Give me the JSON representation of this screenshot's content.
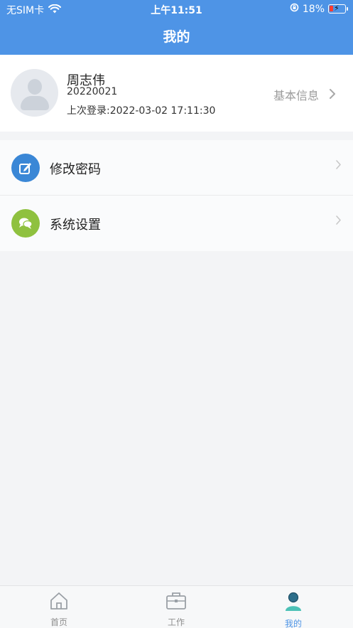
{
  "status_bar": {
    "carrier": "无SIM卡",
    "time": "上午11:51",
    "battery_percent": "18%"
  },
  "header": {
    "title": "我的"
  },
  "profile": {
    "name": "周志伟",
    "id": "20220021",
    "last_login": "上次登录:2022-03-02 17:11:30",
    "basic_info_label": "基本信息"
  },
  "menu": [
    {
      "label": "修改密码",
      "icon": "edit-icon",
      "color": "#3a87d6"
    },
    {
      "label": "系统设置",
      "icon": "chat-bubble-icon",
      "color": "#8fc13f"
    }
  ],
  "tabbar": {
    "tabs": [
      {
        "label": "首页",
        "icon": "home-icon",
        "active": false
      },
      {
        "label": "工作",
        "icon": "briefcase-icon",
        "active": false
      },
      {
        "label": "我的",
        "icon": "user-icon",
        "active": true
      }
    ]
  },
  "colors": {
    "header": "#4e94e6",
    "background": "#f3f4f6",
    "active_tab": "#4e94e6"
  }
}
